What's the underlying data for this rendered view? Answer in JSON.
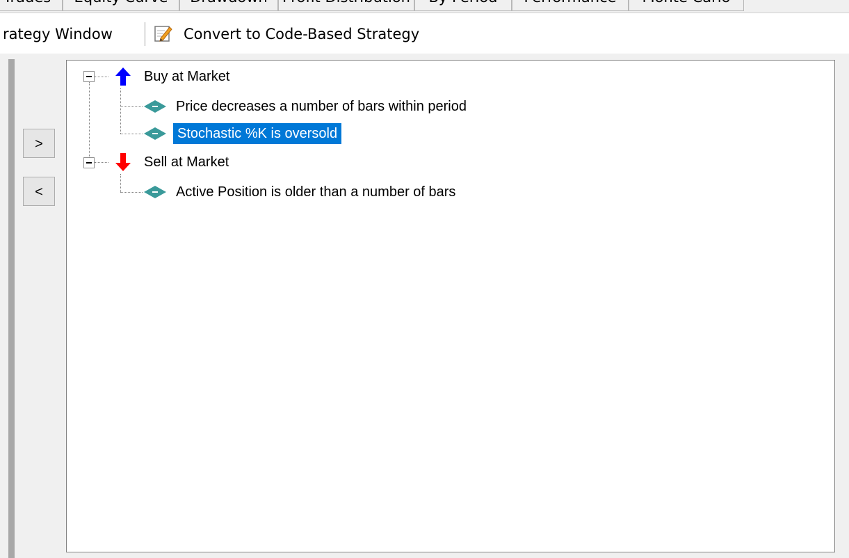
{
  "tabs": [
    {
      "label": "Trades"
    },
    {
      "label": "Equity Curve"
    },
    {
      "label": "Drawdown"
    },
    {
      "label": "Profit Distribution"
    },
    {
      "label": "By Period"
    },
    {
      "label": "Performance"
    },
    {
      "label": "Monte Carlo"
    }
  ],
  "toolbar": {
    "strategy_window_label": "rategy Window",
    "convert_label": "Convert to Code-Based Strategy",
    "convert_icon": "edit-pencil-icon"
  },
  "buttons": {
    "add_label": ">",
    "remove_label": "<"
  },
  "tree": {
    "buy": {
      "label": "Buy at Market",
      "icon": "arrow-up-icon",
      "color": "#0000ff",
      "conditions": [
        {
          "label": "Price decreases a number of bars within period",
          "selected": false
        },
        {
          "label": "Stochastic %K is oversold",
          "selected": true
        }
      ]
    },
    "sell": {
      "label": "Sell at Market",
      "icon": "arrow-down-icon",
      "color": "#ff0000",
      "conditions": [
        {
          "label": "Active Position is older than a number of bars",
          "selected": false
        }
      ]
    },
    "condition_icon_color": "#3a9a9a",
    "selection_color": "#0078d7"
  }
}
